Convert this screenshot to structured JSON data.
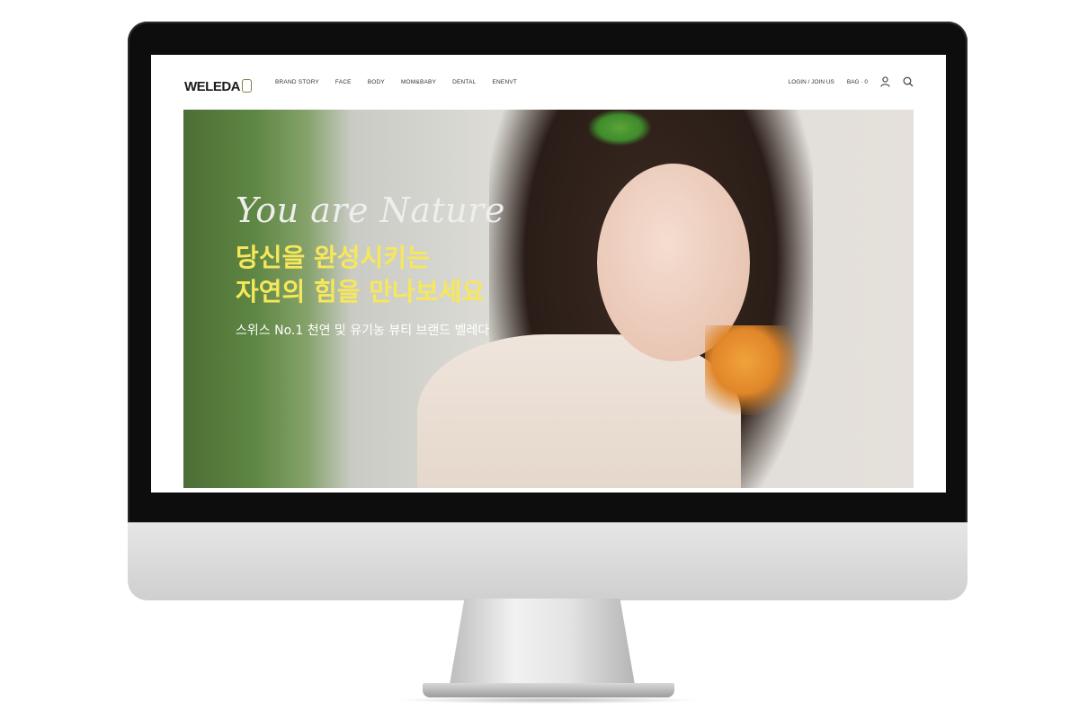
{
  "brand": {
    "logo": "WELEDA"
  },
  "nav": {
    "menu": [
      "BRAND STORY",
      "FACE",
      "BODY",
      "MOM&BABY",
      "DENTAL",
      "ENENVT"
    ],
    "login": "LOGIN / JOIN US",
    "bag": "BAG · 0",
    "icons": [
      "user-icon",
      "search-icon"
    ]
  },
  "hero": {
    "script": "You are Nature",
    "headline_line1": "당신을 완성시키는",
    "headline_line2": "자연의 힘을 만나보세요",
    "subtext": "스위스 No.1 천연 및 유기농 뷰티 브랜드 벨레다"
  },
  "colors": {
    "headline": "#f6e75b",
    "script": "#eeeeee",
    "monitor_bezel": "#0d0d0d"
  }
}
